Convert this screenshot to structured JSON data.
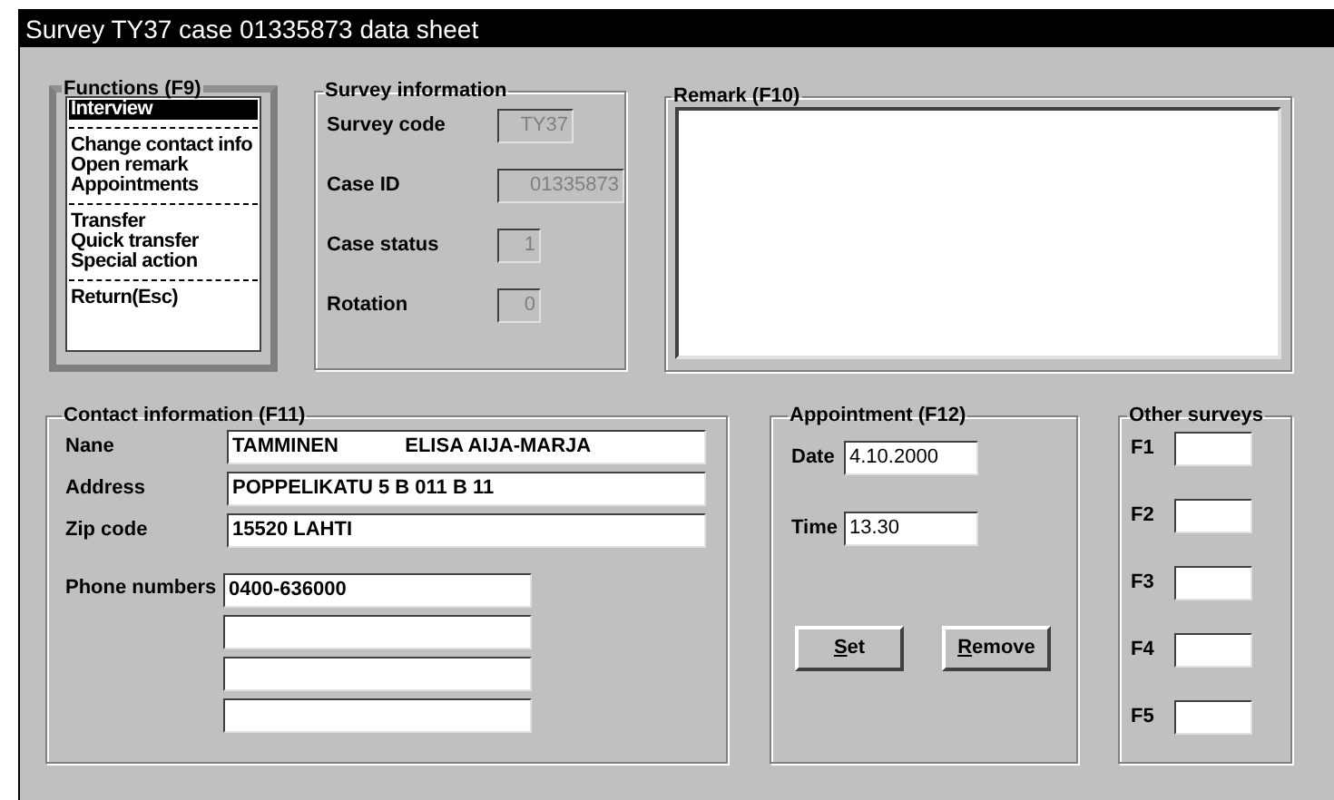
{
  "window": {
    "title": "Survey TY37 case 01335873 data sheet"
  },
  "functions": {
    "title": "Functions (F9)",
    "items": [
      {
        "kind": "item",
        "label": "Interview",
        "selected": true
      },
      {
        "kind": "separator"
      },
      {
        "kind": "item",
        "label": "Change contact info",
        "selected": false
      },
      {
        "kind": "item",
        "label": "Open remark",
        "selected": false
      },
      {
        "kind": "item",
        "label": "Appointments",
        "selected": false
      },
      {
        "kind": "separator"
      },
      {
        "kind": "item",
        "label": "Transfer",
        "selected": false
      },
      {
        "kind": "item",
        "label": "Quick transfer",
        "selected": false
      },
      {
        "kind": "item",
        "label": "Special action",
        "selected": false
      },
      {
        "kind": "separator"
      },
      {
        "kind": "item",
        "label": "Return(Esc)",
        "selected": false
      }
    ]
  },
  "survey_information": {
    "title": "Survey information",
    "fields": [
      {
        "label": "Survey code",
        "value": "TY37",
        "disabled": true
      },
      {
        "label": "Case ID",
        "value": "01335873",
        "disabled": true
      },
      {
        "label": "Case status",
        "value": "1",
        "disabled": true
      },
      {
        "label": "Rotation",
        "value": "0",
        "disabled": true
      }
    ]
  },
  "remark": {
    "title": "Remark (F10)"
  },
  "contact_information": {
    "title": "Contact information (F11)",
    "fields": [
      {
        "label": "Nane",
        "value": "TAMMINEN            ELISA AIJA-MARJA"
      },
      {
        "label": "Address",
        "value": "POPPELIKATU 5 B 011 B 11"
      },
      {
        "label": "Zip code",
        "value": "15520 LAHTI"
      }
    ],
    "phone_label": "Phone numbers",
    "phones": [
      "0400-636000"
    ]
  },
  "appointment": {
    "title": "Appointment (F12)",
    "fields": [
      {
        "label": "Date",
        "value": "4.10.2000"
      },
      {
        "label": "Time",
        "value": "13.30"
      }
    ],
    "buttons": [
      {
        "label": "Set",
        "mnemonic": true
      },
      {
        "label": "Remove",
        "mnemonic": true
      }
    ]
  },
  "other_surveys": {
    "title": "Other surveys",
    "fields": [
      {
        "label": "F1"
      },
      {
        "label": "F2"
      },
      {
        "label": "F3"
      },
      {
        "label": "F4"
      },
      {
        "label": "F5"
      }
    ]
  }
}
